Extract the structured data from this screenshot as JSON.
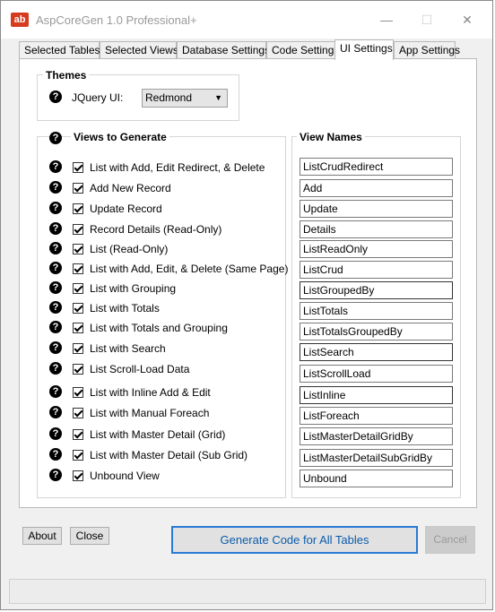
{
  "window": {
    "title": "AspCoreGen 1.0 Professional+",
    "icon_text": "ab"
  },
  "title_buttons": {
    "minimize": "—",
    "maximize": "☐",
    "close": "✕"
  },
  "tabs": [
    {
      "label": "Selected Tables",
      "active": false
    },
    {
      "label": "Selected Views",
      "active": false
    },
    {
      "label": "Database Settings",
      "active": false
    },
    {
      "label": "Code Settings",
      "active": false
    },
    {
      "label": "UI Settings",
      "active": true
    },
    {
      "label": "App Settings",
      "active": false
    }
  ],
  "themes": {
    "title": "Themes",
    "jquery_label": "JQuery UI:",
    "jquery_value": "Redmond"
  },
  "views": {
    "title": "Views to Generate",
    "names_title": "View Names",
    "items": [
      {
        "label": "List with Add, Edit Redirect, & Delete",
        "checked": true,
        "name": "ListCrudRedirect"
      },
      {
        "label": "Add New Record",
        "checked": true,
        "name": "Add"
      },
      {
        "label": "Update Record",
        "checked": true,
        "name": "Update"
      },
      {
        "label": "Record Details (Read-Only)",
        "checked": true,
        "name": "Details"
      },
      {
        "label": "List (Read-Only)",
        "checked": true,
        "name": "ListReadOnly"
      },
      {
        "label": "List with Add, Edit, & Delete (Same Page)",
        "checked": true,
        "name": "ListCrud"
      },
      {
        "label": "List with Grouping",
        "checked": true,
        "name": "ListGroupedBy"
      },
      {
        "label": "List with Totals",
        "checked": true,
        "name": "ListTotals"
      },
      {
        "label": "List with Totals and Grouping",
        "checked": true,
        "name": "ListTotalsGroupedBy"
      },
      {
        "label": "List with Search",
        "checked": true,
        "name": "ListSearch"
      },
      {
        "label": "List Scroll-Load Data",
        "checked": true,
        "name": "ListScrollLoad"
      },
      {
        "label": "List with Inline Add & Edit",
        "checked": true,
        "name": "ListInline"
      },
      {
        "label": "List with Manual Foreach",
        "checked": true,
        "name": "ListForeach"
      },
      {
        "label": "List with Master Detail (Grid)",
        "checked": true,
        "name": "ListMasterDetailGridBy"
      },
      {
        "label": "List with Master Detail (Sub Grid)",
        "checked": true,
        "name": "ListMasterDetailSubGridBy"
      },
      {
        "label": "Unbound View",
        "checked": true,
        "name": "Unbound"
      }
    ]
  },
  "buttons": {
    "about": "About",
    "close": "Close",
    "generate": "Generate Code for All Tables",
    "cancel": "Cancel"
  },
  "colors": {
    "accent": "#2a7ad6",
    "brand": "#d63a1f"
  }
}
